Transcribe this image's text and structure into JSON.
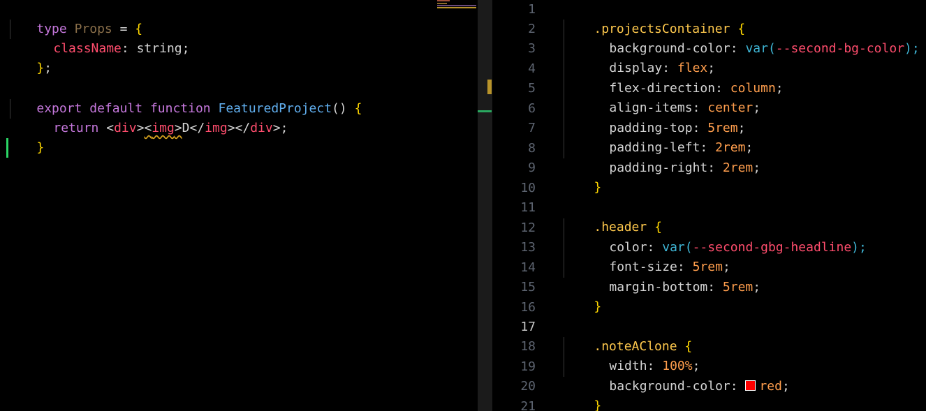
{
  "left_editor": {
    "lines": [
      {
        "t1": "type",
        "t2": "Props",
        "t3": "=",
        "t4": "{"
      },
      {
        "prop": "className",
        "colon": ":",
        "type": "string;"
      },
      {
        "close": "}",
        "semi": ";"
      },
      {},
      {
        "k1": "export",
        "k2": "default",
        "k3": "function",
        "name": "FeaturedProject",
        "paren": "()",
        "brace": "{"
      },
      {
        "ret": "return",
        "lt1": "<",
        "div1": "div",
        "gt1": ">",
        "lt2": "<",
        "img1": "img",
        "gt2": ">",
        "text": "D",
        "lt3": "</",
        "img2": "img",
        "gt3": ">",
        "lt4": "</",
        "div2": "div",
        "gt4": ">",
        "semi": ";"
      },
      {
        "close": "}"
      }
    ]
  },
  "right_editor": {
    "line_numbers": [
      "1",
      "2",
      "3",
      "4",
      "5",
      "6",
      "7",
      "8",
      "9",
      "10",
      "11",
      "12",
      "13",
      "14",
      "15",
      "16",
      "17",
      "18",
      "19",
      "20",
      "21"
    ],
    "active_line": "17",
    "lines": [
      {
        "sel": ".projectsContainer",
        "brace": "{"
      },
      {
        "prop": "background-color:",
        "fn": "var(",
        "v": "--second-bg-color",
        "close": ");"
      },
      {
        "prop": "display:",
        "v": "flex",
        "semi": ";"
      },
      {
        "prop": "flex-direction:",
        "v": "column",
        "semi": ";"
      },
      {
        "prop": "align-items:",
        "v": "center",
        "semi": ";"
      },
      {
        "prop": "padding-top:",
        "v": "5rem",
        "semi": ";"
      },
      {
        "prop": "padding-left:",
        "v": "2rem",
        "semi": ";"
      },
      {
        "prop": "padding-right:",
        "v": "2rem",
        "semi": ";"
      },
      {
        "brace": "}"
      },
      {},
      {
        "sel": ".header",
        "brace": "{"
      },
      {
        "prop": "color:",
        "fn": "var(",
        "v": "--second-gbg-headline",
        "close": ");"
      },
      {
        "prop": "font-size:",
        "v": "5rem",
        "semi": ";"
      },
      {
        "prop": "margin-bottom:",
        "v": "5rem",
        "semi": ";"
      },
      {
        "brace": "}"
      },
      {},
      {
        "sel": ".noteAClone",
        "brace": "{"
      },
      {
        "prop": "width:",
        "v": "100%",
        "semi": ";"
      },
      {
        "prop": "background-color:",
        "v": "red",
        "semi": ";",
        "swatch_color": "#ff0000"
      },
      {
        "brace": "}"
      },
      {}
    ]
  }
}
